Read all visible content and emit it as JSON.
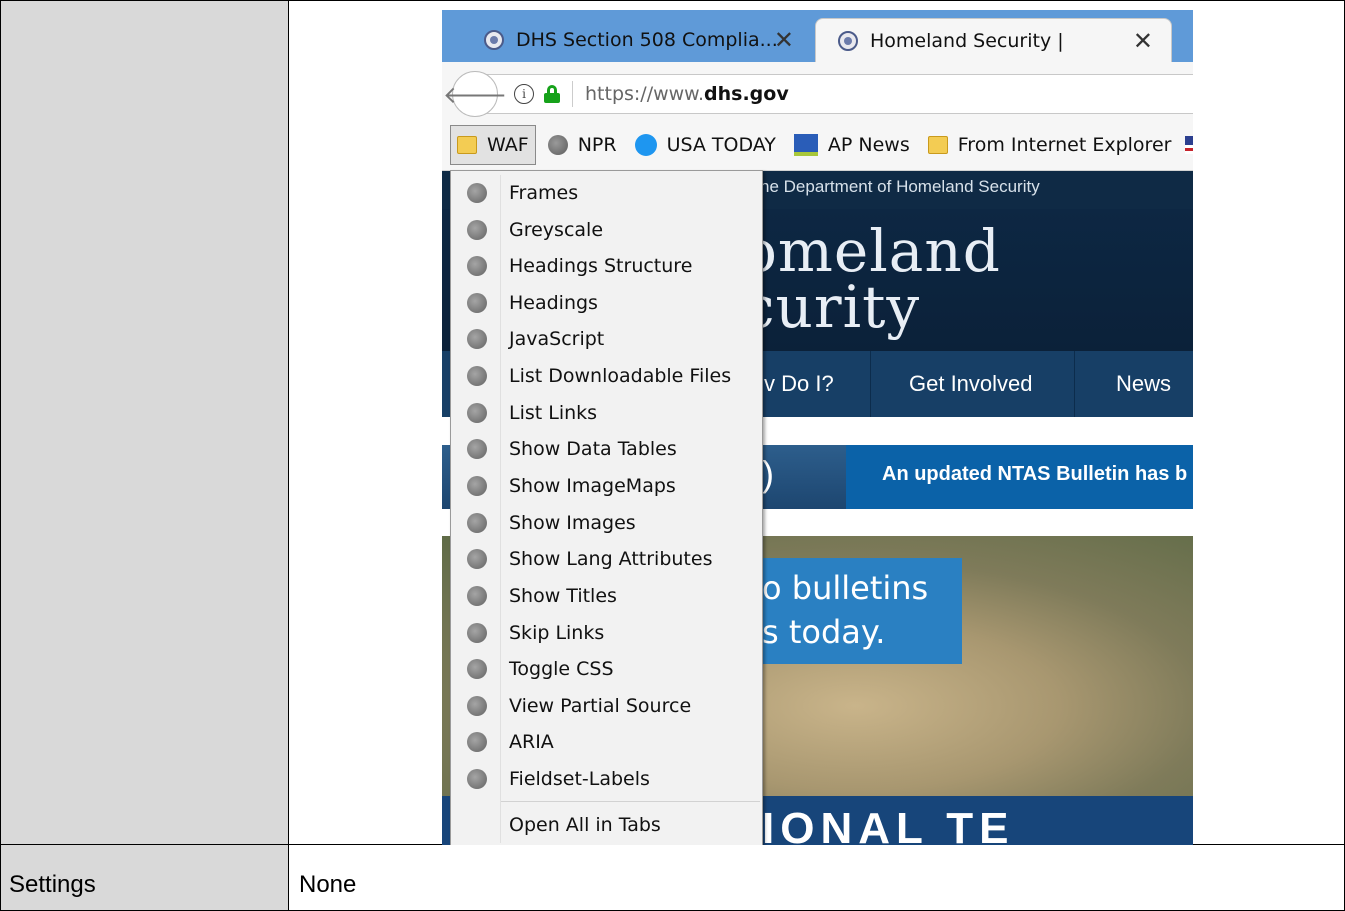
{
  "table": {
    "settings_label": "Settings",
    "settings_value": "None"
  },
  "browser": {
    "tabs": [
      {
        "title": "DHS Section 508 Complia...",
        "close": "✕"
      },
      {
        "title": "Homeland Security |",
        "close": "✕"
      }
    ],
    "url": {
      "prefix": "https://www.",
      "domain": "dhs.gov"
    },
    "bookmarks": [
      {
        "label": "WAF",
        "icon": "folder-icon"
      },
      {
        "label": "NPR",
        "icon": "globe-icon"
      },
      {
        "label": "USA TODAY",
        "icon": "usa-today-dot-icon"
      },
      {
        "label": "AP News",
        "icon": "ap-news-icon"
      },
      {
        "label": "From Internet Explorer",
        "icon": "folder-icon"
      }
    ]
  },
  "site": {
    "topbar_text": "he Department of Homeland Security",
    "title_line1": "omeland",
    "title_line2": "curity",
    "nav": [
      "v Do I?",
      "Get Involved",
      "News"
    ],
    "alert_left": ")",
    "alert_text": "An updated NTAS Bulletin has b",
    "hero_line1": "o bulletins",
    "hero_line2": "s today.",
    "hero_bottom": "IONAL TE"
  },
  "menu": {
    "items": [
      "Frames",
      "Greyscale",
      "Headings Structure",
      "Headings",
      "JavaScript",
      "List Downloadable Files",
      "List Links",
      "Show Data Tables",
      "Show ImageMaps",
      "Show Images",
      "Show Lang Attributes",
      "Show Titles",
      "Skip Links",
      "Toggle CSS",
      "View Partial Source",
      "ARIA",
      "Fieldset-Labels"
    ],
    "open_all": "Open All in Tabs"
  }
}
